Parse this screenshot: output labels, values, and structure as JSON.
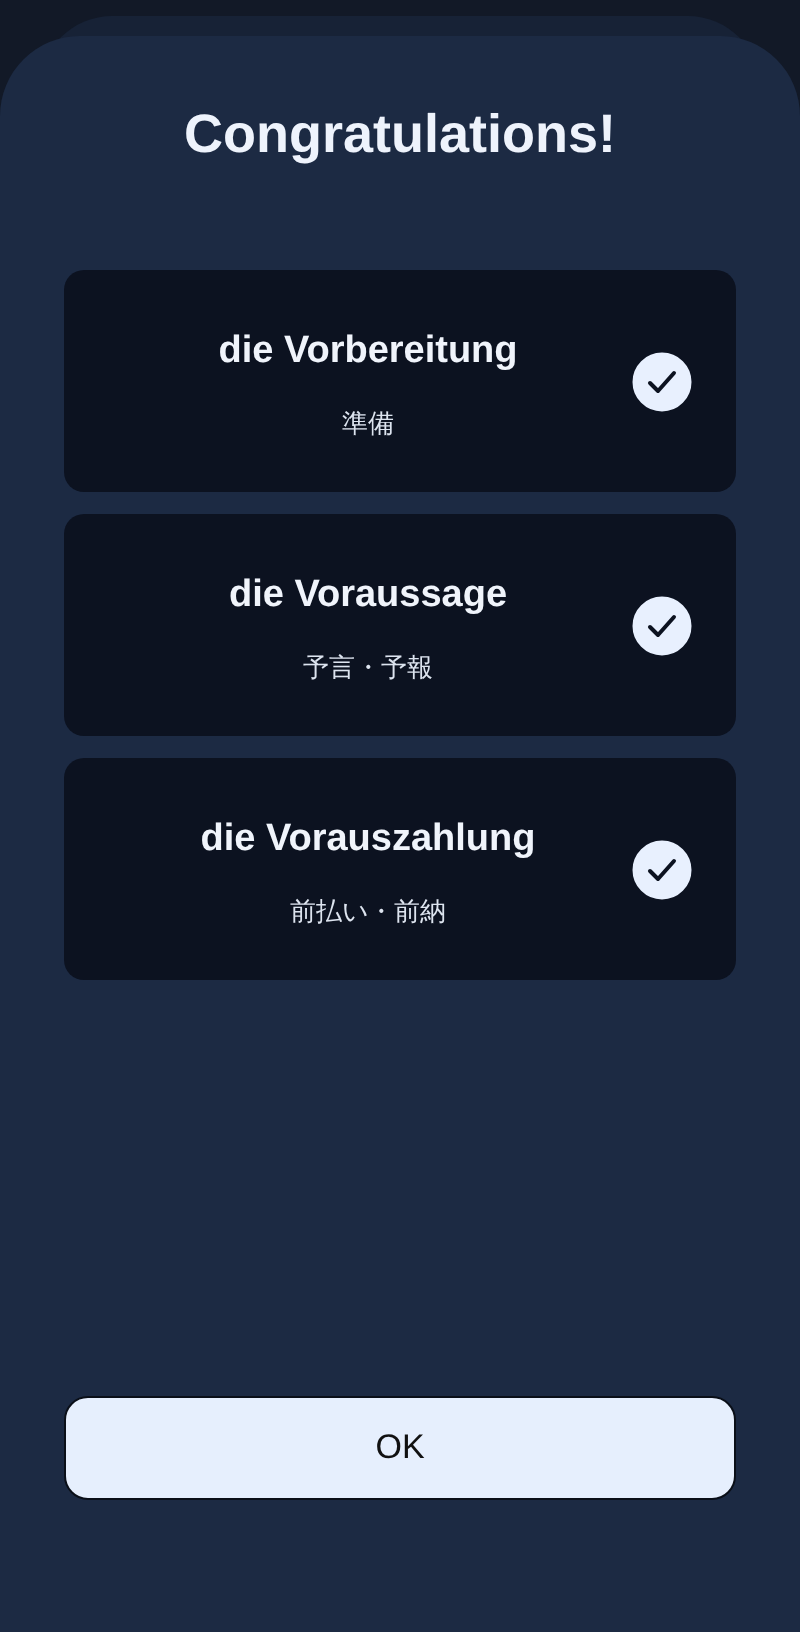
{
  "title": "Congratulations!",
  "words": [
    {
      "word": "die Vorbereitung",
      "translation": "準備",
      "checked": true
    },
    {
      "word": "die Voraussage",
      "translation": "予言・予報",
      "checked": true
    },
    {
      "word": "die Vorauszahlung",
      "translation": "前払い・前納",
      "checked": true
    }
  ],
  "button": "OK"
}
